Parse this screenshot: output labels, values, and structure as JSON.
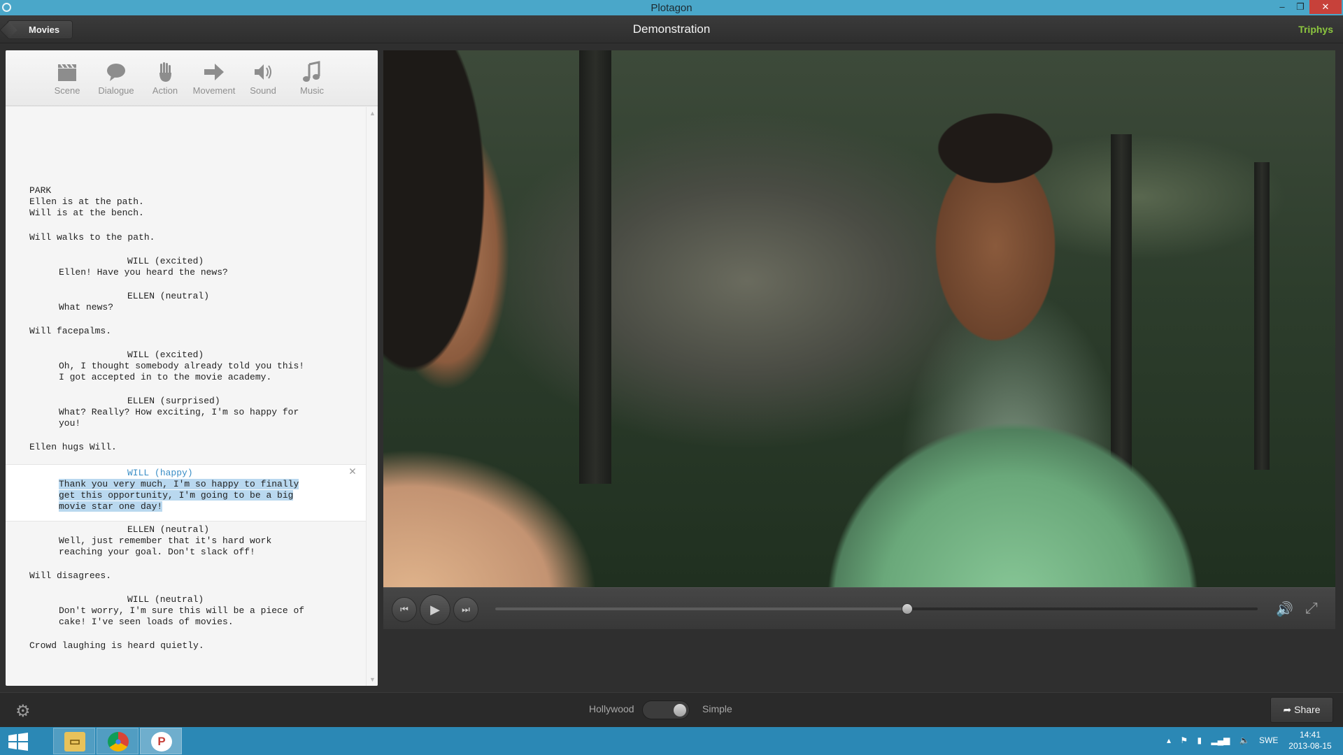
{
  "window": {
    "title": "Plotagon",
    "minimize": "–",
    "restore": "❐",
    "close": "✕"
  },
  "header": {
    "back_button": "Movies",
    "project_title": "Demonstration",
    "user": "Triphys"
  },
  "toolbar": {
    "items": [
      {
        "label": "Scene",
        "icon": "clapperboard-icon"
      },
      {
        "label": "Dialogue",
        "icon": "speech-bubble-icon"
      },
      {
        "label": "Action",
        "icon": "hand-icon"
      },
      {
        "label": "Movement",
        "icon": "arrow-right-icon"
      },
      {
        "label": "Sound",
        "icon": "speaker-icon"
      },
      {
        "label": "Music",
        "icon": "music-note-icon"
      }
    ]
  },
  "script": {
    "lines": [
      "PARK",
      "Ellen is at the path.",
      "Will is at the bench.",
      "Will walks to the path.",
      "WILL (excited)",
      "Ellen! Have you heard the news?",
      "ELLEN (neutral)",
      "What news?",
      "Will facepalms.",
      "WILL (excited)",
      "Oh, I thought somebody already told you this!",
      "I got accepted in to the movie academy.",
      "ELLEN (surprised)",
      "What? Really? How exciting, I'm so happy for",
      "you!",
      "Ellen hugs Will.",
      "WILL (",
      "happy",
      ")",
      "Thank you very much, I'm so happy to finally",
      "get this opportunity, I'm going to be a big",
      "movie star one day!",
      "ELLEN (neutral)",
      "Well, just remember that it's hard work",
      "reaching your goal. Don't slack off!",
      "Will disagrees.",
      "WILL (neutral)",
      "Don't worry, I'm sure this will be a piece of",
      "cake! I've seen loads of movies.",
      "Crowd laughing is heard quietly."
    ]
  },
  "player": {
    "progress": 0.54,
    "prev_icon": "skip-back-icon",
    "play_icon": "play-icon",
    "next_icon": "skip-forward-icon"
  },
  "bottom": {
    "mode_left": "Hollywood",
    "mode_right": "Simple",
    "mode_selected": "Simple",
    "share": "Share"
  },
  "taskbar": {
    "language": "SWE",
    "time": "14:41",
    "date": "2013-08-15"
  }
}
